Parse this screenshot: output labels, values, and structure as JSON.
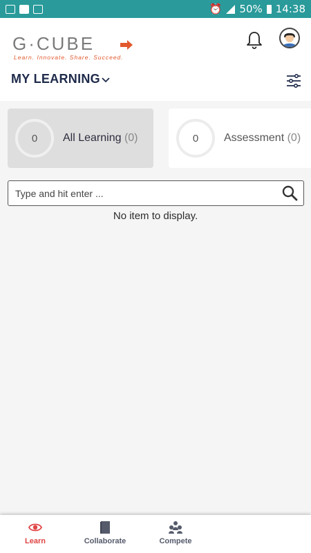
{
  "status_bar": {
    "battery": "50%",
    "time": "14:38"
  },
  "header": {
    "logo_text": "G·CUBE",
    "logo_tagline": "Learn. Innovate. Share. Succeed.",
    "title": "MY LEARNING"
  },
  "tabs": [
    {
      "count": "0",
      "label": "All Learning",
      "badge": "(0)"
    },
    {
      "count": "0",
      "label": "Assessment",
      "badge": "(0)"
    }
  ],
  "search": {
    "placeholder": "Type and hit enter ..."
  },
  "empty_message": "No item to display.",
  "bottom_nav": [
    {
      "label": "Learn",
      "icon": "eye-icon"
    },
    {
      "label": "Collaborate",
      "icon": "book-icon"
    },
    {
      "label": "Compete",
      "icon": "group-icon"
    }
  ],
  "colors": {
    "status_bar": "#2a9a9a",
    "accent": "#e04343",
    "title": "#1e2a4a"
  }
}
